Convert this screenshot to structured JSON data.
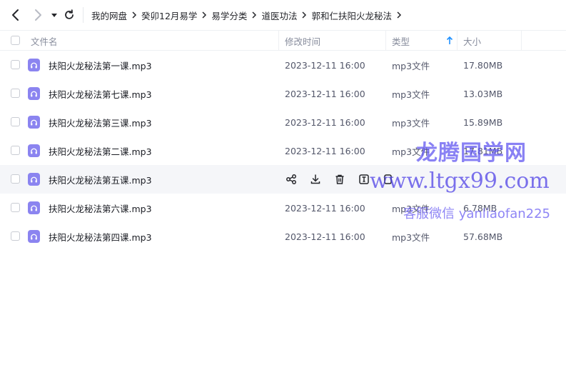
{
  "toolbar": {
    "back_icon": "chevron-left-icon",
    "forward_icon": "chevron-right-icon",
    "dropdown_icon": "caret-down-icon",
    "refresh_icon": "refresh-icon"
  },
  "breadcrumb": [
    "我的网盘",
    "癸卯12月易学",
    "易学分类",
    "道医功法",
    "郭和仁扶阳火龙秘法"
  ],
  "columns": {
    "name": "文件名",
    "mtime": "修改时间",
    "type": "类型",
    "size": "大小",
    "sort_icon": "arrow-up-icon",
    "accent": "#1e90ff"
  },
  "files": [
    {
      "name": "扶阳火龙秘法第一课.mp3",
      "mtime": "2023-12-11 16:00",
      "type": "mp3文件",
      "size": "17.80MB"
    },
    {
      "name": "扶阳火龙秘法第七课.mp3",
      "mtime": "2023-12-11 16:00",
      "type": "mp3文件",
      "size": "13.03MB"
    },
    {
      "name": "扶阳火龙秘法第三课.mp3",
      "mtime": "2023-12-11 16:00",
      "type": "mp3文件",
      "size": "15.89MB"
    },
    {
      "name": "扶阳火龙秘法第二课.mp3",
      "mtime": "2023-12-11 16:00",
      "type": "mp3文件",
      "size": "17.81MB"
    },
    {
      "name": "扶阳火龙秘法第五课.mp3",
      "mtime": "",
      "type": "",
      "size": "",
      "hovered": true
    },
    {
      "name": "扶阳火龙秘法第六课.mp3",
      "mtime": "2023-12-11 16:00",
      "type": "mp3文件",
      "size": "6.78MB"
    },
    {
      "name": "扶阳火龙秘法第四课.mp3",
      "mtime": "2023-12-11 16:00",
      "type": "mp3文件",
      "size": "57.68MB"
    }
  ],
  "row_actions": [
    "share-icon",
    "download-icon",
    "delete-icon",
    "rename-icon",
    "more-icon"
  ],
  "file_icon": "audio-file-icon",
  "file_icon_color": "#8b84f0",
  "watermark": {
    "line1": "龙腾国学网",
    "line2": "www.ltgx99.com",
    "line3": "客服微信 yanliaofan225"
  }
}
